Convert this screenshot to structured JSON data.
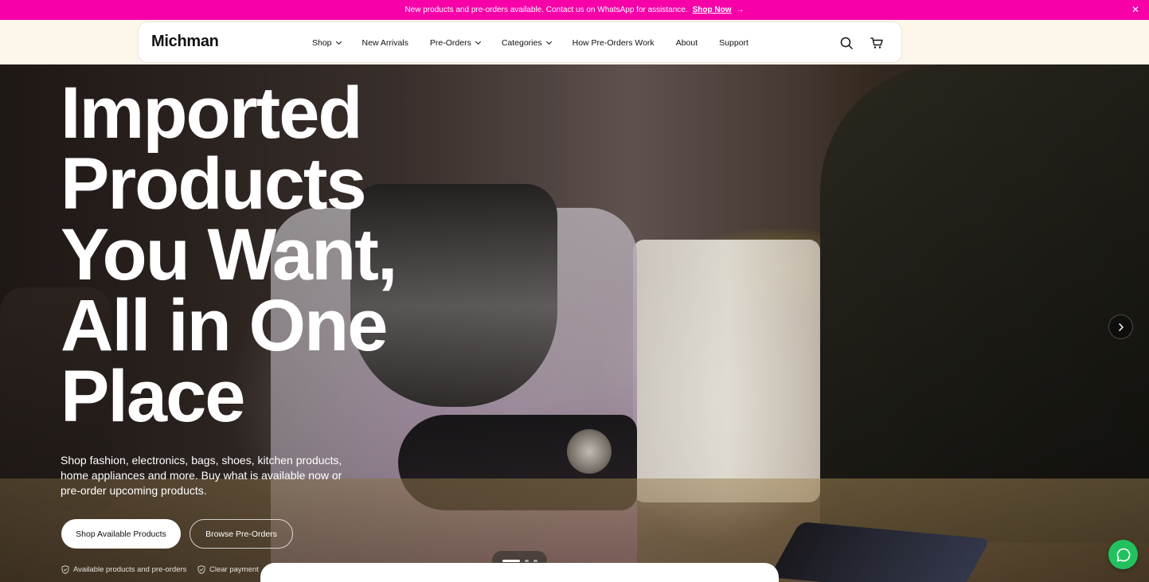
{
  "announcement": {
    "text": "New products and pre-orders available. Contact us on WhatsApp for assistance.",
    "link_label": "Shop Now",
    "link_arrow": "→",
    "close_label": "✕"
  },
  "header": {
    "brand": "Michman",
    "nav": [
      {
        "label": "Shop",
        "dropdown": true
      },
      {
        "label": "New Arrivals",
        "dropdown": false
      },
      {
        "label": "Pre-Orders",
        "dropdown": true
      },
      {
        "label": "Categories",
        "dropdown": true
      },
      {
        "label": "How Pre-Orders Work",
        "dropdown": false
      },
      {
        "label": "About",
        "dropdown": false
      },
      {
        "label": "Support",
        "dropdown": false
      }
    ],
    "icons": [
      "search-icon",
      "cart-icon"
    ]
  },
  "hero": {
    "title_lines": [
      "Imported",
      "Products",
      "You Want,",
      "All in One",
      "Place"
    ],
    "subtitle": "Shop fashion, electronics, bags, shoes, kitchen products, home appliances and more. Buy what is available now or pre-order upcoming products.",
    "primary_button": "Shop Available Products",
    "secondary_button": "Browse Pre-Orders",
    "badges": [
      "Available products and pre-orders",
      "Clear payment i"
    ],
    "slides_total": 3,
    "active_slide": 1
  },
  "colors": {
    "announcement_bg": "#f700a8",
    "header_strip_bg": "#fdf6ea",
    "chat_button": "#22c15e"
  }
}
